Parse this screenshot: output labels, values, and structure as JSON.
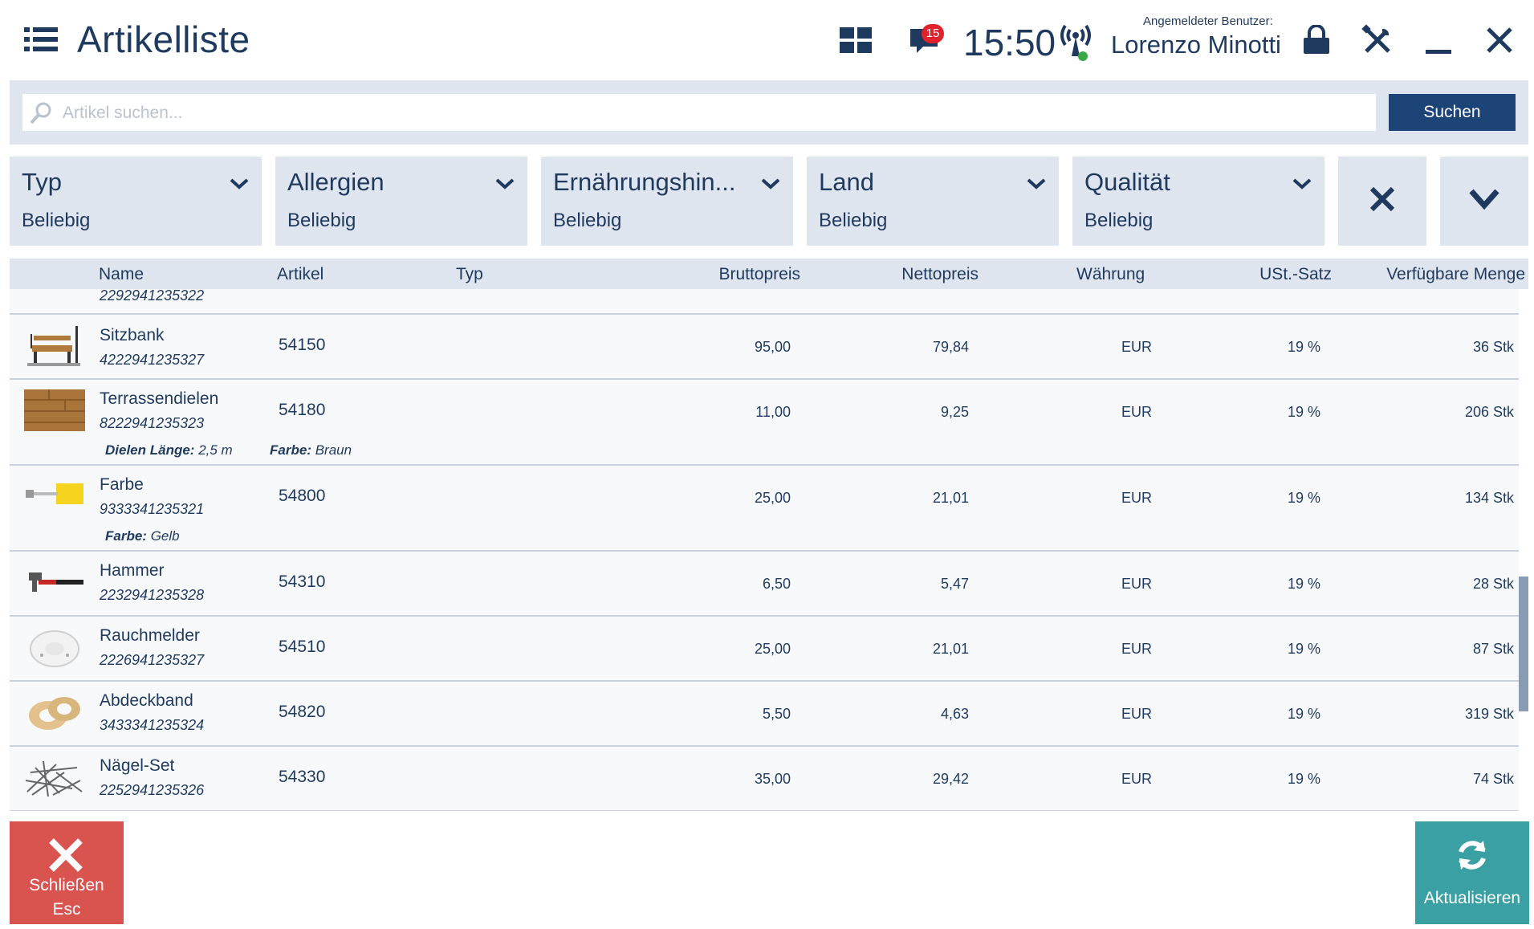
{
  "header": {
    "title": "Artikelliste",
    "notification_count": "15",
    "clock": "15:50",
    "user_caption": "Angemeldeter Benutzer:",
    "user_name": "Lorenzo Minotti",
    "icons": [
      "menu-icon",
      "grid-icon",
      "notification-icon",
      "signal-icon",
      "lock-icon",
      "tools-icon",
      "minimize-icon",
      "close-icon"
    ]
  },
  "search": {
    "placeholder": "Artikel suchen...",
    "value": "",
    "button_label": "Suchen"
  },
  "filters": [
    {
      "label": "Typ",
      "value": "Beliebig"
    },
    {
      "label": "Allergien",
      "value": "Beliebig"
    },
    {
      "label": "Ernährungshin...",
      "value": "Beliebig"
    },
    {
      "label": "Land",
      "value": "Beliebig"
    },
    {
      "label": "Qualität",
      "value": "Beliebig"
    }
  ],
  "table": {
    "columns": {
      "name": "Name",
      "artikel": "Artikel",
      "typ": "Typ",
      "brutto": "Bruttopreis",
      "netto": "Nettopreis",
      "waehrung": "Währung",
      "ust": "USt.-Satz",
      "menge": "Verfügbare Menge"
    },
    "partial_row_code": "2292941235322",
    "rows": [
      {
        "name": "Sitzbank",
        "code": "4222941235327",
        "artikel": "54150",
        "brutto": "95,00",
        "netto": "79,84",
        "waehrung": "EUR",
        "ust": "19 %",
        "menge": "36 Stk",
        "image": "bench"
      },
      {
        "name": "Terrassendielen",
        "code": "8222941235323",
        "artikel": "54180",
        "brutto": "11,00",
        "netto": "9,25",
        "waehrung": "EUR",
        "ust": "19 %",
        "menge": "206 Stk",
        "image": "planks",
        "attributes": [
          {
            "key": "Dielen Länge:",
            "value": "2,5 m"
          },
          {
            "key": "Farbe:",
            "value": "Braun"
          }
        ]
      },
      {
        "name": "Farbe",
        "code": "9333341235321",
        "artikel": "54800",
        "brutto": "25,00",
        "netto": "21,01",
        "waehrung": "EUR",
        "ust": "19 %",
        "menge": "134 Stk",
        "image": "paint-roller",
        "attributes": [
          {
            "key": "Farbe:",
            "value": "Gelb"
          }
        ]
      },
      {
        "name": "Hammer",
        "code": "2232941235328",
        "artikel": "54310",
        "brutto": "6,50",
        "netto": "5,47",
        "waehrung": "EUR",
        "ust": "19 %",
        "menge": "28 Stk",
        "image": "hammer"
      },
      {
        "name": "Rauchmelder",
        "code": "2226941235327",
        "artikel": "54510",
        "brutto": "25,00",
        "netto": "21,01",
        "waehrung": "EUR",
        "ust": "19 %",
        "menge": "87 Stk",
        "image": "smoke-detector"
      },
      {
        "name": "Abdeckband",
        "code": "3433341235324",
        "artikel": "54820",
        "brutto": "5,50",
        "netto": "4,63",
        "waehrung": "EUR",
        "ust": "19 %",
        "menge": "319 Stk",
        "image": "tape"
      },
      {
        "name": "Nägel-Set",
        "code": "2252941235326",
        "artikel": "54330",
        "brutto": "35,00",
        "netto": "29,42",
        "waehrung": "EUR",
        "ust": "19 %",
        "menge": "74 Stk",
        "image": "nails"
      }
    ]
  },
  "footer": {
    "close_label": "Schließen",
    "close_shortcut": "Esc",
    "refresh_label": "Aktualisieren"
  },
  "colors": {
    "primary": "#1d4477",
    "text": "#1f3a5f",
    "panel": "#dfe5ee",
    "close": "#d9534f",
    "refresh": "#3aa0a3",
    "badge": "#e0222c"
  }
}
